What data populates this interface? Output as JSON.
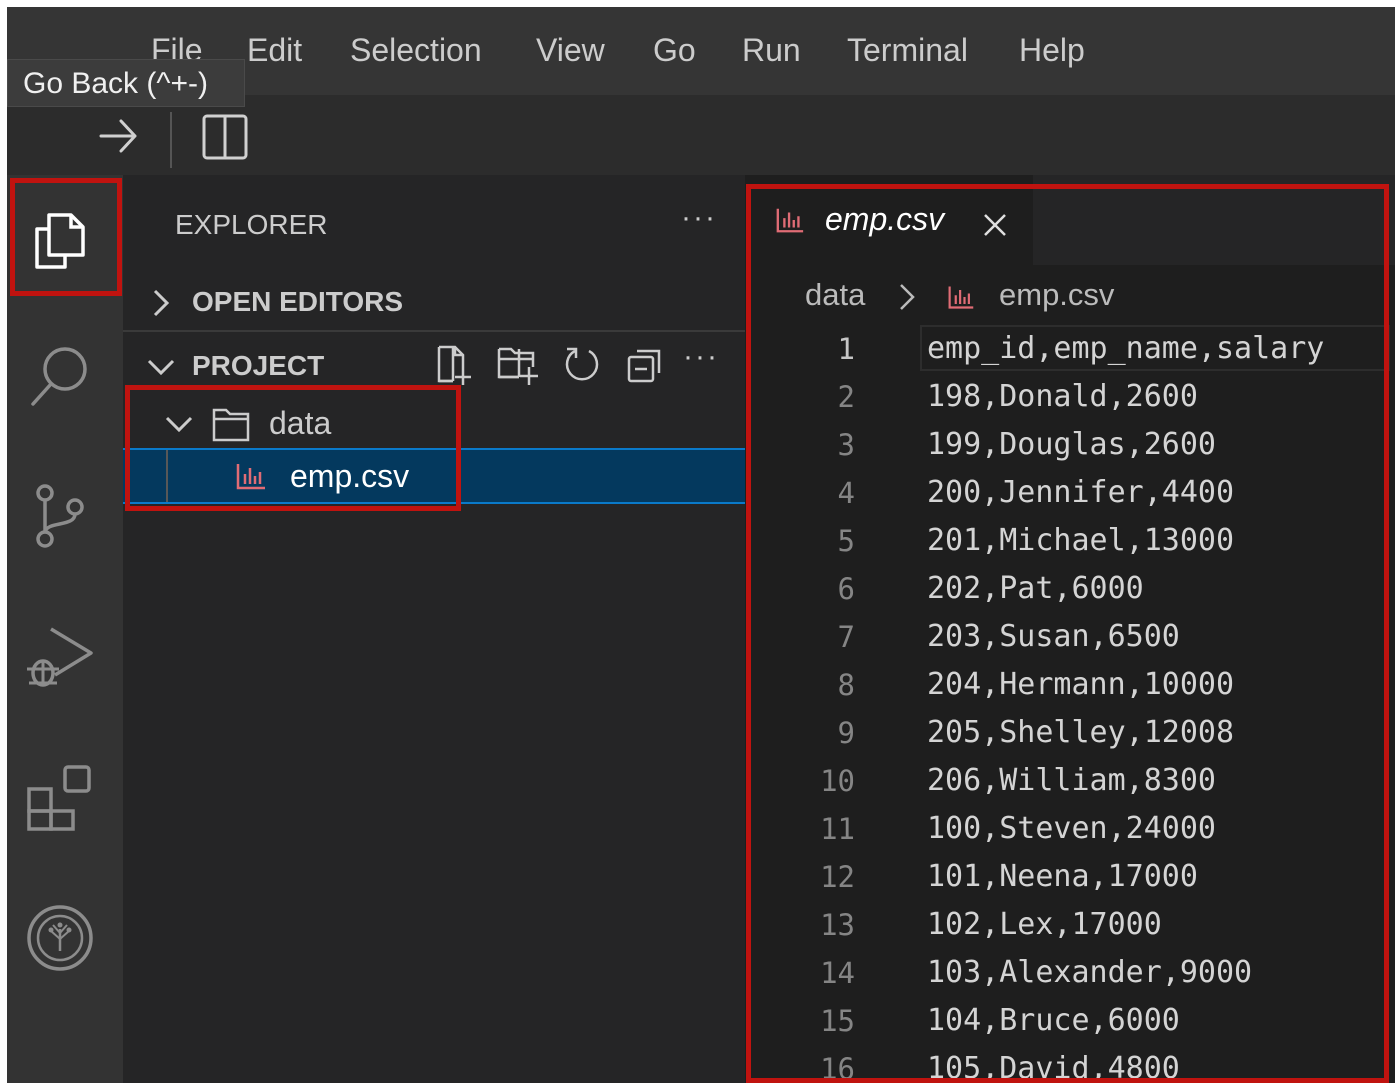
{
  "menu": {
    "items": [
      "File",
      "Edit",
      "Selection",
      "View",
      "Go",
      "Run",
      "Terminal",
      "Help"
    ]
  },
  "tooltip": {
    "text": "Go Back (^+-)"
  },
  "sidebar": {
    "title": "EXPLORER",
    "more": "···",
    "open_editors": "OPEN EDITORS",
    "project": "PROJECT",
    "folder": "data",
    "file": "emp.csv"
  },
  "editor": {
    "tab_label": "emp.csv",
    "breadcrumb_folder": "data",
    "breadcrumb_file": "emp.csv",
    "line_numbers": [
      "1",
      "2",
      "3",
      "4",
      "5",
      "6",
      "7",
      "8",
      "9",
      "10",
      "11",
      "12",
      "13",
      "14",
      "15",
      "16"
    ],
    "lines": [
      "emp_id,emp_name,salary",
      "198,Donald,2600",
      "199,Douglas,2600",
      "200,Jennifer,4400",
      "201,Michael,13000",
      "202,Pat,6000",
      "203,Susan,6500",
      "204,Hermann,10000",
      "205,Shelley,12008",
      "206,William,8300",
      "100,Steven,24000",
      "101,Neena,17000",
      "102,Lex,17000",
      "103,Alexander,9000",
      "104,Bruce,6000",
      "105,David,4800"
    ]
  },
  "colors": {
    "highlight": "#c0130f",
    "csv_icon": "#e06c75",
    "selection": "#04395e"
  }
}
